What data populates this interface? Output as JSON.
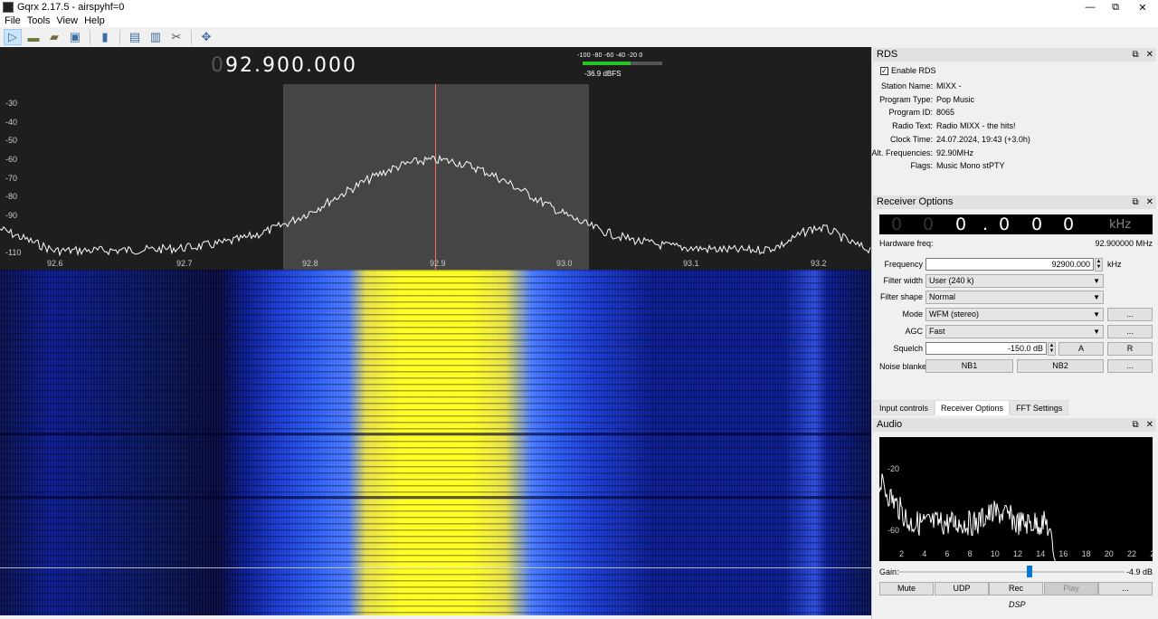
{
  "window": {
    "title": "Gqrx 2.17.5 - airspyhf=0",
    "minimize": "—",
    "restore": "⧉",
    "close": "✕"
  },
  "menu": [
    "File",
    "Tools",
    "View",
    "Help"
  ],
  "toolbar_icons": [
    "play-icon",
    "device-icon",
    "folder-icon",
    "save-icon",
    "bookmark-icon",
    "remote-icon",
    "screen-icon",
    "tools-icon",
    "move-icon"
  ],
  "fft": {
    "frequency_dim": "0",
    "frequency": "92.900.000",
    "y_ticks": [
      "-30",
      "-40",
      "-50",
      "-60",
      "-70",
      "-80",
      "-90",
      "-110"
    ],
    "x_ticks": [
      "92.6",
      "92.7",
      "92.8",
      "92.9",
      "93.0",
      "93.1",
      "93.2"
    ],
    "meter_scale": "-100  -80  -60  -40  -20   0",
    "meter_level_fraction": 0.6,
    "meter_reading": "-36.9 dBFS"
  },
  "rds": {
    "title": "RDS",
    "enable_label": "Enable RDS",
    "enable_checked": "✓",
    "rows": [
      {
        "label": "Station Name:",
        "value": "MIXX -"
      },
      {
        "label": "Program Type:",
        "value": "Pop Music"
      },
      {
        "label": "Program ID:",
        "value": "8065"
      },
      {
        "label": "Radio Text:",
        "value": "Radio MIXX - the hits!"
      },
      {
        "label": "Clock Time:",
        "value": "24.07.2024, 19:43 (+3.0h)"
      },
      {
        "label": "Alt. Frequencies:",
        "value": "92.90MHz"
      },
      {
        "label": "Flags:",
        "value": "Music Mono stPTY"
      }
    ]
  },
  "receiver": {
    "title": "Receiver Options",
    "digits": [
      "0",
      "0",
      "0",
      ".",
      "0",
      "0",
      "0"
    ],
    "digits_unit": "kHz",
    "hw_label": "Hardware freq:",
    "hw_value": "92.900000 MHz",
    "frequency_label": "Frequency",
    "frequency_value": "92900.000",
    "frequency_unit": "kHz",
    "filter_width_label": "Filter width",
    "filter_width_value": "User (240 k)",
    "filter_shape_label": "Filter shape",
    "filter_shape_value": "Normal",
    "mode_label": "Mode",
    "mode_value": "WFM (stereo)",
    "agc_label": "AGC",
    "agc_value": "Fast",
    "squelch_label": "Squelch",
    "squelch_value": "-150.0 dB",
    "squelch_a": "A",
    "squelch_r": "R",
    "nb_label": "Noise blanker",
    "nb1": "NB1",
    "nb2": "NB2",
    "more": "..."
  },
  "tabs": [
    "Input controls",
    "Receiver Options",
    "FFT Settings"
  ],
  "audio": {
    "title": "Audio",
    "y_ticks": [
      "-20",
      "-60"
    ],
    "x_ticks": [
      "2",
      "4",
      "6",
      "8",
      "10",
      "12",
      "14",
      "16",
      "18",
      "20",
      "22",
      "2"
    ],
    "gain_label": "Gain:",
    "gain_value": "-4.9 dB",
    "gain_fraction": 0.58,
    "buttons": [
      "Mute",
      "UDP",
      "Rec",
      "Play",
      "..."
    ],
    "dsp_label": "DSP"
  }
}
